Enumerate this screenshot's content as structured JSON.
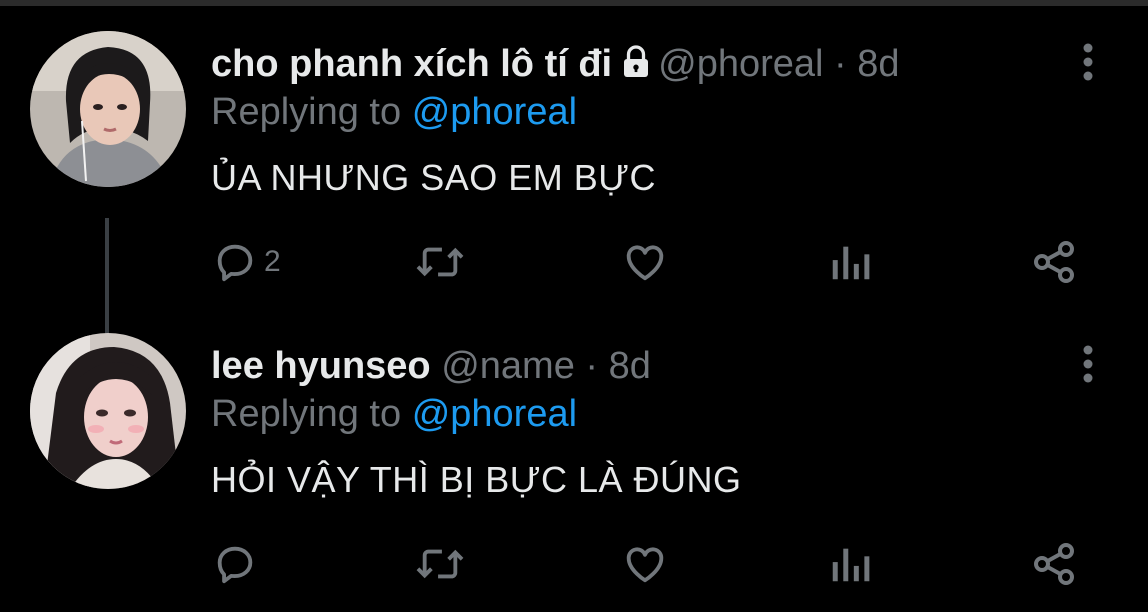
{
  "tweets": [
    {
      "display_name": "cho phanh xích lô tí đi",
      "handle": "@phoreal",
      "separator": "·",
      "time": "8d",
      "replying_prefix": "Replying to",
      "replying_handle": "@phoreal",
      "text": "ỦA NHƯNG SAO EM BỰC",
      "reply_count": "2",
      "locked": true
    },
    {
      "display_name": "lee hyunseo",
      "handle": "@name",
      "separator": "·",
      "time": "8d",
      "replying_prefix": "Replying to",
      "replying_handle": "@phoreal",
      "text": "HỎI VẬY THÌ BỊ BỰC LÀ ĐÚNG",
      "reply_count": "",
      "locked": false
    }
  ],
  "icons": [
    "lock-icon",
    "more-options-icon",
    "reply-icon",
    "retweet-icon",
    "like-icon",
    "analytics-icon",
    "share-icon"
  ],
  "colors": {
    "background": "#000000",
    "text": "#e7e9ea",
    "muted": "#71767b",
    "link": "#1d9bf0",
    "thread_line": "#3a3f44"
  }
}
